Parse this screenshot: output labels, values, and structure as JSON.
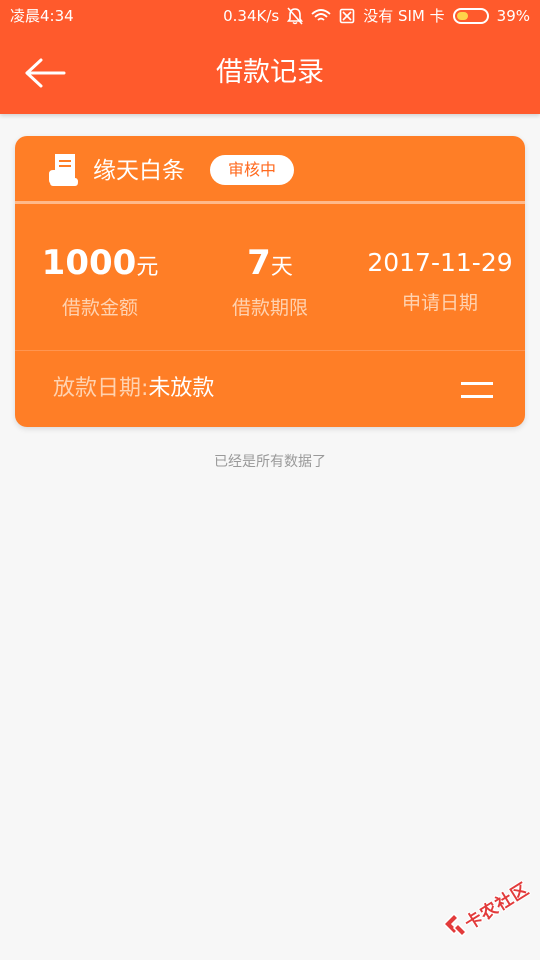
{
  "status_bar": {
    "time": "凌晨4:34",
    "network_speed": "0.34K/s",
    "carrier": "没有 SIM 卡",
    "battery_percent": "39%",
    "battery_level": 0.39
  },
  "nav": {
    "title": "借款记录",
    "back_icon": "arrow-left-icon"
  },
  "loan": {
    "product_name": "缘天白条",
    "product_icon": "scroll-icon",
    "status": "审核中",
    "amount": {
      "value": "1000",
      "unit": "元",
      "label": "借款金额"
    },
    "term": {
      "value": "7",
      "unit": "天",
      "label": "借款期限"
    },
    "apply_date": {
      "value": "2017-11-29",
      "label": "申请日期"
    },
    "disburse_label": "放款日期:",
    "disburse_value": "未放款",
    "menu_icon": "menu-icon"
  },
  "list_end_notice": "已经是所有数据了",
  "watermark": {
    "text": "卡农社区"
  },
  "colors": {
    "header": "#ff5a2c",
    "card": "#ff7e26",
    "badge_text": "#ff6a1f",
    "background": "#f7f7f7"
  }
}
